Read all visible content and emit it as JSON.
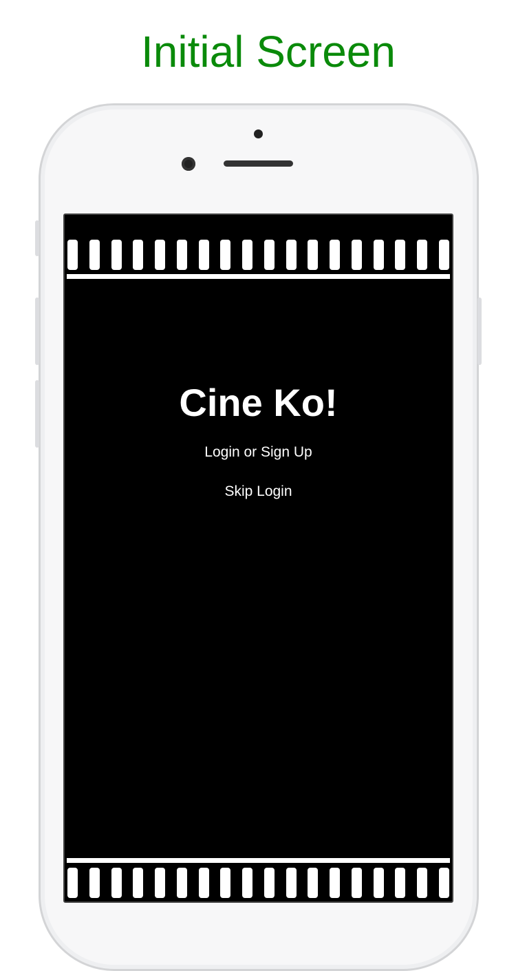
{
  "caption": "Initial Screen",
  "app": {
    "title": "Cine Ko!",
    "login_label": "Login or Sign Up",
    "skip_label": "Skip Login"
  },
  "colors": {
    "caption": "#0a8a0a",
    "screen_bg": "#000000",
    "film": "#ffffff"
  }
}
